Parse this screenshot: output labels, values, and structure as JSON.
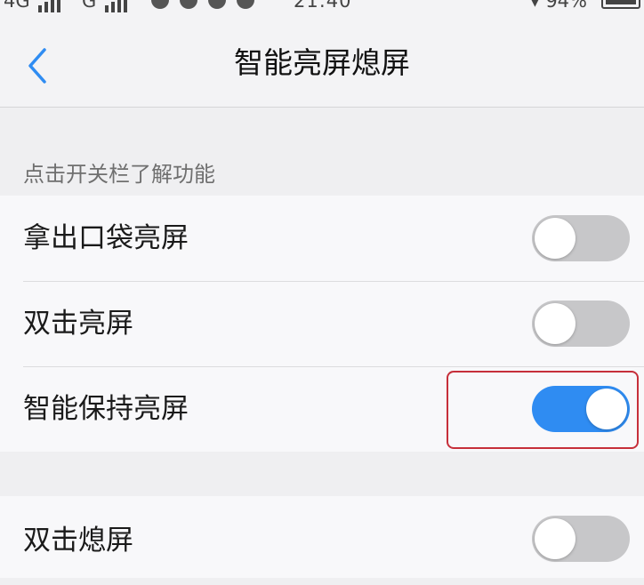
{
  "status_bar": {
    "network_1": "4G",
    "network_2": "G",
    "time": "21:40",
    "battery": "94%"
  },
  "nav": {
    "back_icon": "chevron-left-icon",
    "title": "智能亮屏熄屏"
  },
  "section_header": "点击开关栏了解功能",
  "settings": [
    {
      "label": "拿出口袋亮屏",
      "enabled": false
    },
    {
      "label": "双击亮屏",
      "enabled": false
    },
    {
      "label": "智能保持亮屏",
      "enabled": true,
      "highlighted": true
    }
  ],
  "settings_2": [
    {
      "label": "双击熄屏",
      "enabled": false
    }
  ],
  "colors": {
    "accent": "#2f8cf2",
    "toggle_off": "#c7c7c9",
    "highlight": "#c62f3a",
    "background": "#efeff1"
  }
}
